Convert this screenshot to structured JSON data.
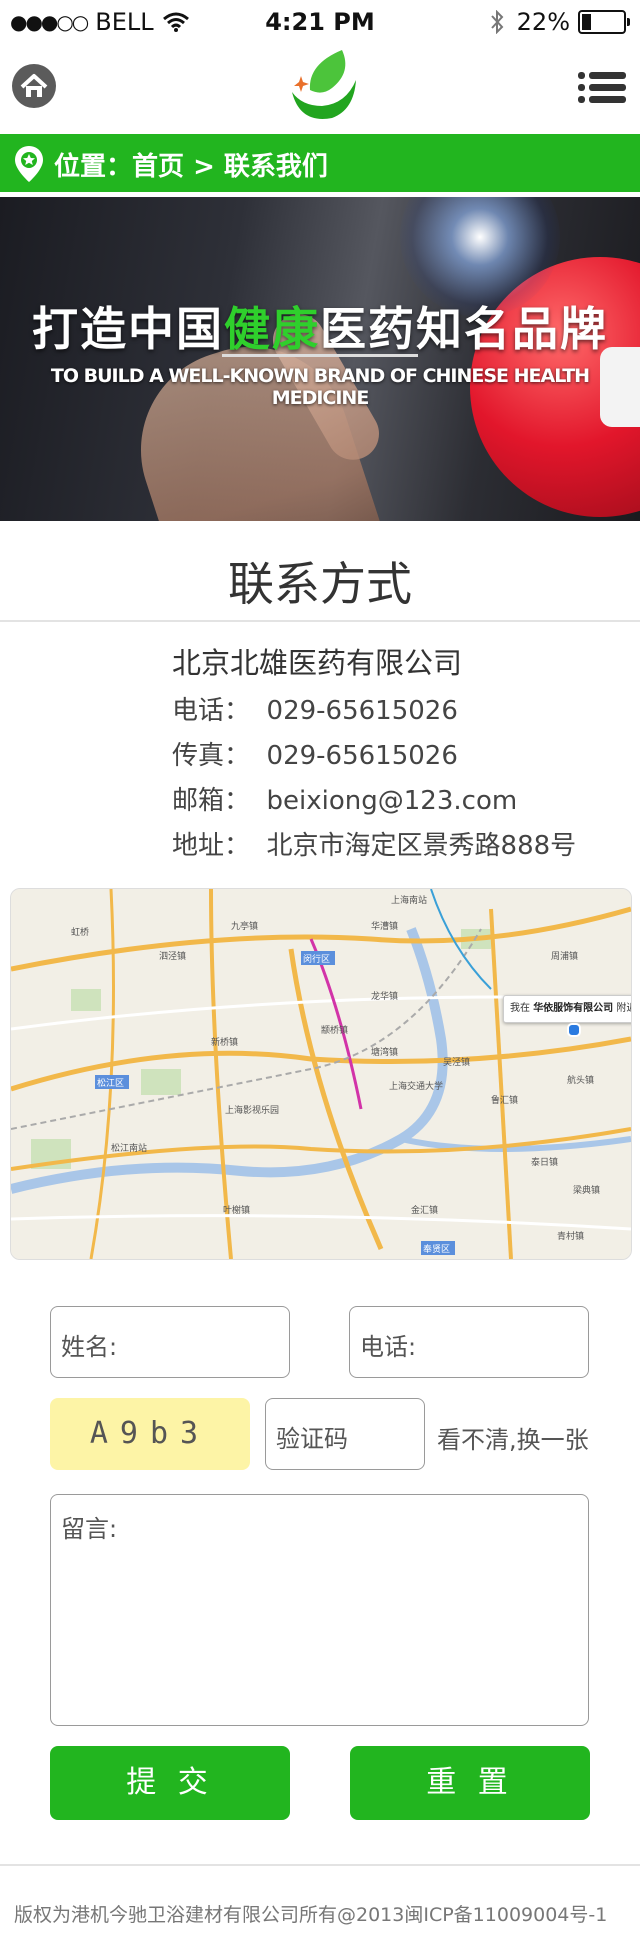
{
  "status_bar": {
    "carrier": "BELL",
    "time": "4:21 PM",
    "battery": "22%",
    "battery_level": 0.22
  },
  "location": {
    "prefix": "位置：",
    "home": "首页",
    "separator": " > ",
    "current": "联系我们"
  },
  "banner": {
    "title_part1": "打造中国",
    "title_highlight": "健康",
    "title_part2": "医药知名品牌",
    "subtitle": "TO BUILD A WELL-KNOWN BRAND OF CHINESE HEALTH MEDICINE"
  },
  "section": {
    "title": "联系方式"
  },
  "contact": {
    "company": "北京北雄医药有限公司",
    "phone": "电话：  029-65615026",
    "fax": "传真：  029-65615026",
    "email": "邮箱：  beixiong@123.com",
    "address": "地址：  北京市海定区景秀路888号"
  },
  "map": {
    "popup_prefix": "我在",
    "popup_name": "华依服饰有限公司",
    "popup_suffix": "附近",
    "labels": [
      "上海南站",
      "虹桥",
      "闵行区",
      "松江区",
      "九亭镇",
      "泗泾镇",
      "新桥镇",
      "颛桥镇",
      "塘湾镇",
      "吴泾镇",
      "鲁汇镇",
      "航头镇",
      "泰日镇",
      "梁典镇",
      "叶榭镇",
      "金汇镇",
      "青村镇",
      "奉贤区",
      "上海交通大学",
      "上海影视乐园",
      "松江南站",
      "周浦镇",
      "华漕镇",
      "龙华镇"
    ]
  },
  "form": {
    "name_placeholder": "姓名:",
    "phone_placeholder": "电话:",
    "captcha": "A9b3",
    "captcha_placeholder": "验证码",
    "refresh_label": "看不清,换一张",
    "message_placeholder": "留言:",
    "submit_label": "提 交",
    "reset_label": "重 置"
  },
  "footer": {
    "text": "版权为港机今驰卫浴建材有限公司所有@2013闽ICP备11009004号-1"
  },
  "colors": {
    "brand_green": "#22b51f",
    "captcha_bg": "#fdf4a6"
  }
}
